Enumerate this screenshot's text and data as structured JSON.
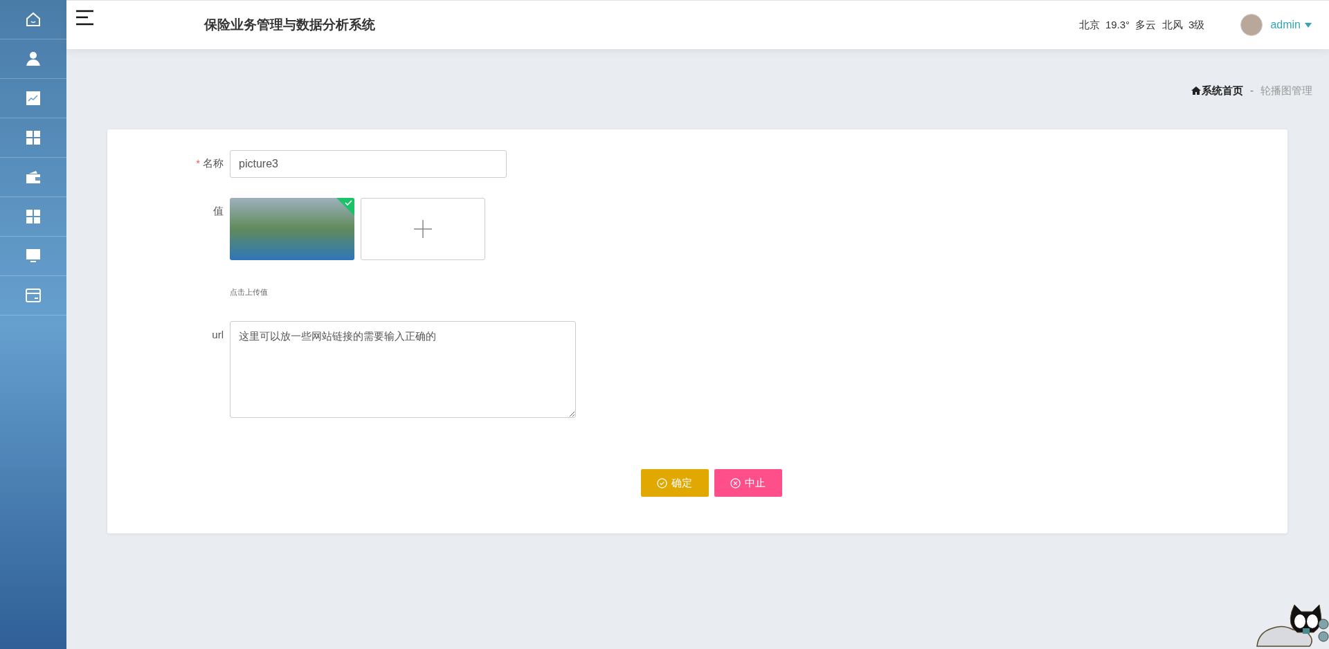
{
  "header": {
    "title": "保险业务管理与数据分析系统",
    "weather": "北京  19.3°  多云  北风  3级",
    "user": "admin"
  },
  "breadcrumb": {
    "home": "系统首页",
    "separator": "-",
    "current": "轮播图管理"
  },
  "form": {
    "fields": [
      {
        "kind": "text",
        "label": "名称",
        "required_mark": "*",
        "value": "picture3"
      },
      {
        "kind": "upload",
        "label": "值",
        "hint": "点击上传值"
      },
      {
        "kind": "textarea",
        "label": "url",
        "value": "这里可以放一些网站链接的需要输入正确的"
      }
    ],
    "buttons": [
      {
        "kind": "confirm",
        "label": "确定"
      },
      {
        "kind": "cancel",
        "label": "中止"
      }
    ]
  }
}
